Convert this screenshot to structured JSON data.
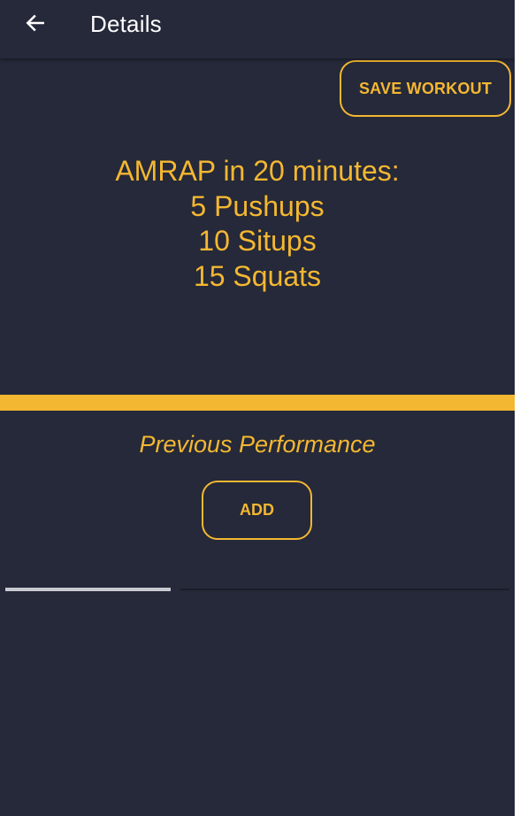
{
  "app_bar": {
    "title": "Details",
    "back_icon": "arrow-left-icon"
  },
  "actions": {
    "save_label": "SAVE WORKOUT"
  },
  "workout": {
    "lines": [
      "AMRAP in 20 minutes:",
      "5 Pushups",
      "10 Situps",
      "15 Squats"
    ]
  },
  "previous_performance": {
    "title": "Previous Performance",
    "add_label": "ADD"
  },
  "colors": {
    "background": "#252939",
    "accent": "#F4B731",
    "text_primary": "#FFFFFF"
  }
}
